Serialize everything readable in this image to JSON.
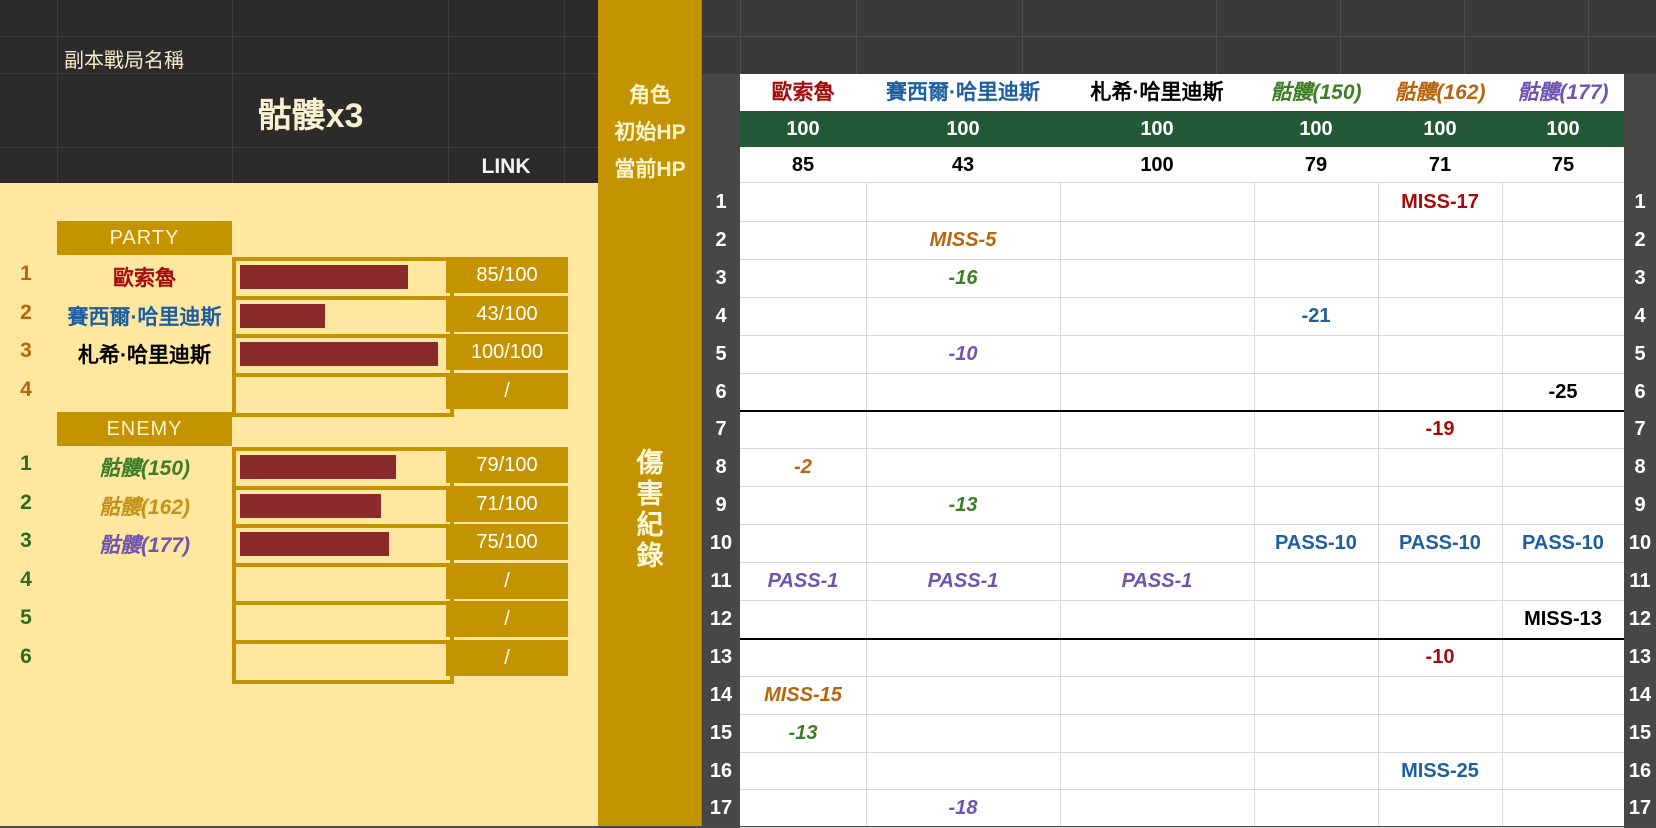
{
  "header": {
    "dungeon_label": "副本戰局名稱",
    "dungeon_name": "骷髏x3",
    "link_label": "LINK"
  },
  "status_panel": {
    "party_label": "PARTY",
    "enemy_label": "ENEMY",
    "party": [
      {
        "num": "1",
        "name": "歐索魯",
        "hp_text": "85/100",
        "hp_fraction": 0.85,
        "color": "#a50d0d"
      },
      {
        "num": "2",
        "name": "賽西爾·哈里迪斯",
        "hp_text": "43/100",
        "hp_fraction": 0.43,
        "color": "#1d5fa0"
      },
      {
        "num": "3",
        "name": "札希·哈里迪斯",
        "hp_text": "100/100",
        "hp_fraction": 1.0,
        "color": "#000000"
      },
      {
        "num": "4",
        "name": "",
        "hp_text": "/",
        "hp_fraction": 0,
        "color": "#000000"
      }
    ],
    "enemies": [
      {
        "num": "1",
        "name": "骷髏(150)",
        "hp_text": "79/100",
        "hp_fraction": 0.79,
        "color": "#3e7e26"
      },
      {
        "num": "2",
        "name": "骷髏(162)",
        "hp_text": "71/100",
        "hp_fraction": 0.71,
        "color": "#c4921a"
      },
      {
        "num": "3",
        "name": "骷髏(177)",
        "hp_text": "75/100",
        "hp_fraction": 0.75,
        "color": "#6f55b0"
      },
      {
        "num": "4",
        "name": "",
        "hp_text": "/",
        "hp_fraction": 0,
        "color": "#000000"
      },
      {
        "num": "5",
        "name": "",
        "hp_text": "/",
        "hp_fraction": 0,
        "color": "#000000"
      },
      {
        "num": "6",
        "name": "",
        "hp_text": "/",
        "hp_fraction": 0,
        "color": "#000000"
      }
    ]
  },
  "gold_column": {
    "role_label": "角色",
    "init_hp_label": "初始HP",
    "current_hp_label": "當前HP",
    "damage_log_label": "傷害紀錄"
  },
  "columns": [
    {
      "name": "歐索魯",
      "init_hp": "100",
      "current_hp": "85",
      "color": "#a50d0d",
      "italic": false
    },
    {
      "name": "賽西爾·哈里迪斯",
      "init_hp": "100",
      "current_hp": "43",
      "color": "#1d5fa0",
      "italic": false
    },
    {
      "name": "札希·哈里迪斯",
      "init_hp": "100",
      "current_hp": "100",
      "color": "#000000",
      "italic": false
    },
    {
      "name": "骷髏(150)",
      "init_hp": "100",
      "current_hp": "79",
      "color": "#3e7e26",
      "italic": true
    },
    {
      "name": "骷髏(162)",
      "init_hp": "100",
      "current_hp": "71",
      "color": "#b8650d",
      "italic": true
    },
    {
      "name": "骷髏(177)",
      "init_hp": "100",
      "current_hp": "75",
      "color": "#6f55b0",
      "italic": true
    }
  ],
  "rows": [
    "1",
    "2",
    "3",
    "4",
    "5",
    "6",
    "7",
    "8",
    "9",
    "10",
    "11",
    "12",
    "13",
    "14",
    "15",
    "16",
    "17"
  ],
  "log_entries": [
    {
      "row": 1,
      "col": 4,
      "text": "MISS-17",
      "color": "#a50d0d",
      "italic": false
    },
    {
      "row": 2,
      "col": 1,
      "text": "MISS-5",
      "color": "#b8650d",
      "italic": true
    },
    {
      "row": 3,
      "col": 1,
      "text": "-16",
      "color": "#3e7e26",
      "italic": true
    },
    {
      "row": 4,
      "col": 3,
      "text": "-21",
      "color": "#1d5fa0",
      "italic": false
    },
    {
      "row": 5,
      "col": 1,
      "text": "-10",
      "color": "#6f55b0",
      "italic": true
    },
    {
      "row": 6,
      "col": 5,
      "text": "-25",
      "color": "#000000",
      "italic": false
    },
    {
      "row": 7,
      "col": 4,
      "text": "-19",
      "color": "#a50d0d",
      "italic": false
    },
    {
      "row": 8,
      "col": 0,
      "text": "-2",
      "color": "#b8650d",
      "italic": true
    },
    {
      "row": 9,
      "col": 1,
      "text": "-13",
      "color": "#3e7e26",
      "italic": true
    },
    {
      "row": 10,
      "col": 3,
      "text": "PASS-10",
      "color": "#1d5fa0",
      "italic": false
    },
    {
      "row": 10,
      "col": 4,
      "text": "PASS-10",
      "color": "#1d5fa0",
      "italic": false
    },
    {
      "row": 10,
      "col": 5,
      "text": "PASS-10",
      "color": "#1d5fa0",
      "italic": false
    },
    {
      "row": 11,
      "col": 0,
      "text": "PASS-1",
      "color": "#6f55b0",
      "italic": true
    },
    {
      "row": 11,
      "col": 1,
      "text": "PASS-1",
      "color": "#6f55b0",
      "italic": true
    },
    {
      "row": 11,
      "col": 2,
      "text": "PASS-1",
      "color": "#6f55b0",
      "italic": true
    },
    {
      "row": 12,
      "col": 5,
      "text": "MISS-13",
      "color": "#000000",
      "italic": false
    },
    {
      "row": 13,
      "col": 4,
      "text": "-10",
      "color": "#a50d0d",
      "italic": false
    },
    {
      "row": 14,
      "col": 0,
      "text": "MISS-15",
      "color": "#b8650d",
      "italic": true
    },
    {
      "row": 15,
      "col": 0,
      "text": "-13",
      "color": "#3e7e26",
      "italic": true
    },
    {
      "row": 16,
      "col": 4,
      "text": "MISS-25",
      "color": "#1d5fa0",
      "italic": false
    },
    {
      "row": 17,
      "col": 1,
      "text": "-18",
      "color": "#6f55b0",
      "italic": true
    }
  ]
}
